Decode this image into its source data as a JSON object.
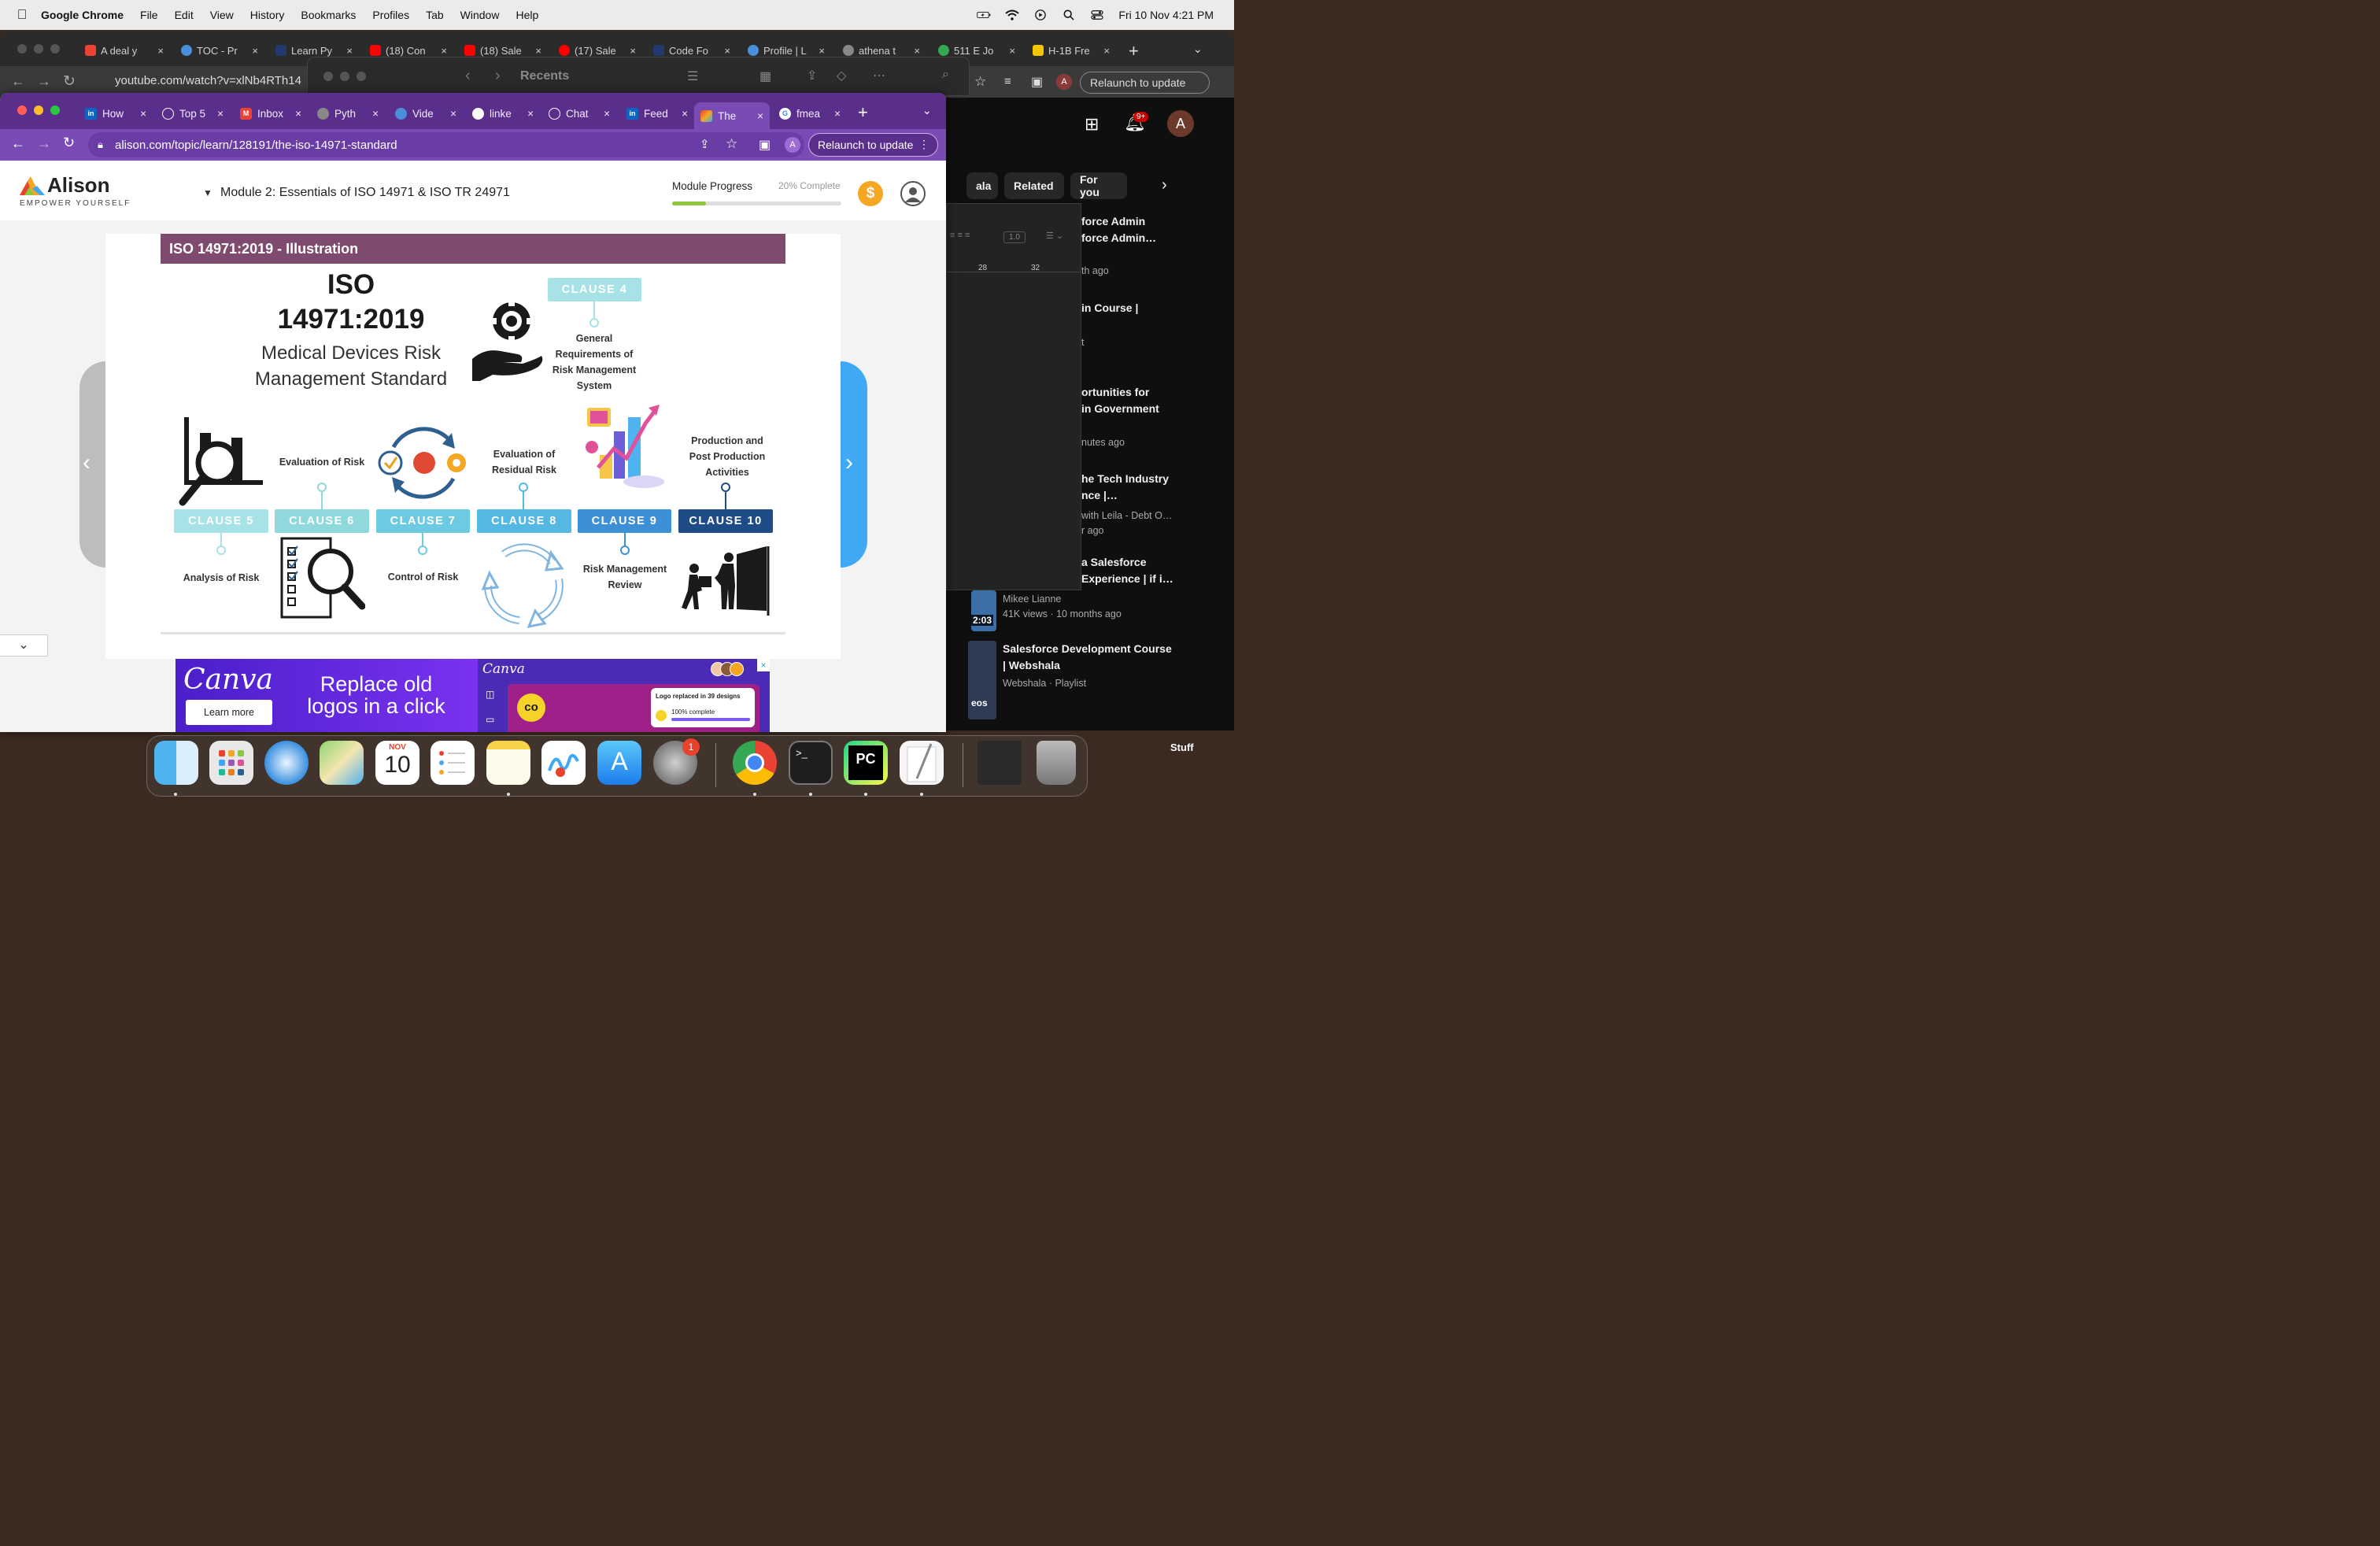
{
  "menubar": {
    "app": "Google Chrome",
    "items": [
      "File",
      "Edit",
      "View",
      "History",
      "Bookmarks",
      "Profiles",
      "Tab",
      "Window",
      "Help"
    ],
    "datetime": "Fri 10 Nov  4:21 PM"
  },
  "bg_window": {
    "tabs": [
      "A deal y",
      "TOC - Pr",
      "Learn Py",
      "(18) Con",
      "(18) Sale",
      "(17) Sale",
      "Code Fo",
      "Profile | L",
      "athena t",
      "511 E Jo",
      "H-1B Fre"
    ],
    "url": "youtube.com/watch?v=xlNb4RTh14",
    "relaunch": "Relaunch to update",
    "profile_initial": "A"
  },
  "finder": {
    "title": "Recents"
  },
  "youtube": {
    "notif_badge": "9+",
    "avatar": "A",
    "chips": [
      "ala",
      "Related",
      "For you"
    ],
    "items": [
      {
        "title": "force Admin\nforce Admin…",
        "meta": "th ago"
      },
      {
        "title": "in Course |",
        "meta": "t"
      },
      {
        "title": "ortunities for\nin Government",
        "meta": "nutes ago"
      },
      {
        "title": "he Tech Industry\nnce |…",
        "meta": "with Leila - Debt O…\nr ago"
      },
      {
        "title": "a Salesforce\nExperience | if i…",
        "meta": ""
      },
      {
        "title": "",
        "meta": "Mikee Lianne\n41K views · 10 months ago"
      },
      {
        "title": "Salesforce Development Course\n| Webshala",
        "meta": "Webshala · Playlist"
      }
    ],
    "thumb_time": "2:03",
    "thumb_label": "eos",
    "doc_zoom": "1.0",
    "ruler": [
      "28",
      "32"
    ]
  },
  "window": {
    "tabs": [
      "How",
      "Top 5",
      "Inbox",
      "Pyth",
      "Vide",
      "linke",
      "Chat",
      "Feed",
      "The",
      "fmea"
    ],
    "active_tab": 8,
    "url": "alison.com/topic/learn/128191/the-iso-14971-standard",
    "relaunch": "Relaunch to update",
    "profile_initial": "A"
  },
  "alison": {
    "brand": "Alison",
    "tagline": "EMPOWER YOURSELF",
    "module_title": "Module 2: Essentials of ISO 14971 & ISO TR 24971",
    "progress_label": "Module Progress",
    "progress_text": "20% Complete",
    "progress_value": 0.2,
    "coin": "$"
  },
  "slide": {
    "banner": "ISO 14971:2019 - Illustration",
    "title_line1": "ISO",
    "title_line2": "14971:2019",
    "subtitle_line1": "Medical Devices Risk",
    "subtitle_line2": "Management Standard",
    "clause4": {
      "label": "CLAUSE 4",
      "caption": "General\nRequirements of\nRisk Management\nSystem"
    },
    "clauses": [
      {
        "label": "CLAUSE 5",
        "caption": "Analysis of Risk",
        "color": "#a7e3e6"
      },
      {
        "label": "CLAUSE 6",
        "caption": "Evaluation of Risk",
        "color": "#8fd8dc"
      },
      {
        "label": "CLAUSE 7",
        "caption": "Control of Risk",
        "color": "#6ccbe0"
      },
      {
        "label": "CLAUSE 8",
        "caption": "Evaluation of\nResidual Risk",
        "color": "#55b8e3"
      },
      {
        "label": "CLAUSE 9",
        "caption": "Risk Management\nReview",
        "color": "#3d8fd6"
      },
      {
        "label": "CLAUSE 10",
        "caption": "Production and\nPost Production\nActivities",
        "color": "#1f4c86"
      }
    ]
  },
  "ad": {
    "logo": "Canva",
    "cta": "Learn more",
    "headline": "Replace old logos in a click",
    "logo2": "Canva",
    "mini_title": "Logo replaced in 39 designs",
    "mini_status": "100% complete",
    "mark": "co"
  },
  "dock": {
    "calendar_month": "NOV",
    "calendar_day": "10",
    "settings_badge": "1",
    "stack_label": "Stuff"
  }
}
